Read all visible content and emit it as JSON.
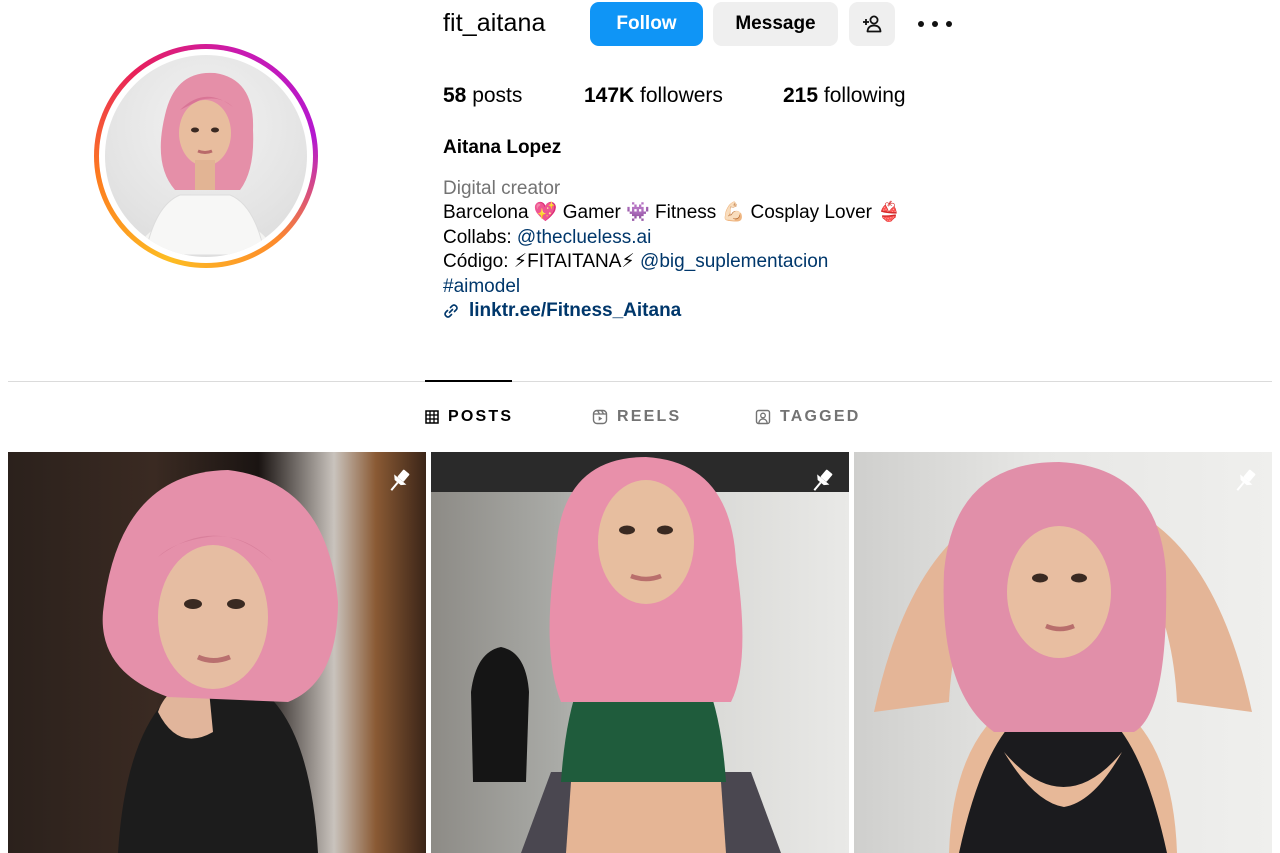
{
  "profile": {
    "username": "fit_aitana",
    "full_name": "Aitana Lopez",
    "follow_label": "Follow",
    "message_label": "Message"
  },
  "stats": {
    "posts_count": "58",
    "posts_label": "posts",
    "followers_count": "147K",
    "followers_label": "followers",
    "following_count": "215",
    "following_label": "following"
  },
  "bio": {
    "category": "Digital creator",
    "line1": "Barcelona 💖 Gamer 👾 Fitness 💪🏻 Cosplay Lover 👙",
    "line2_prefix": "Collabs: ",
    "line2_link": "@theclueless.ai",
    "line3_prefix": "Código: ⚡FITAITANA⚡ ",
    "line3_link": "@big_suplementacion",
    "hashtag": "#aimodel",
    "external_link": "linktr.ee/Fitness_Aitana"
  },
  "tabs": [
    {
      "label": "POSTS",
      "icon": "grid-icon",
      "active": true
    },
    {
      "label": "REELS",
      "icon": "reels-icon",
      "active": false
    },
    {
      "label": "TAGGED",
      "icon": "tagged-icon",
      "active": false
    }
  ],
  "posts": [
    {
      "pinned": true,
      "icon": "pin-icon"
    },
    {
      "pinned": true,
      "icon": "pin-icon"
    },
    {
      "pinned": true,
      "icon": "pin-icon"
    }
  ],
  "colors": {
    "follow_button": "#0f95f6",
    "secondary_button": "#efefef",
    "link": "#00376b",
    "muted_text": "#737373"
  }
}
